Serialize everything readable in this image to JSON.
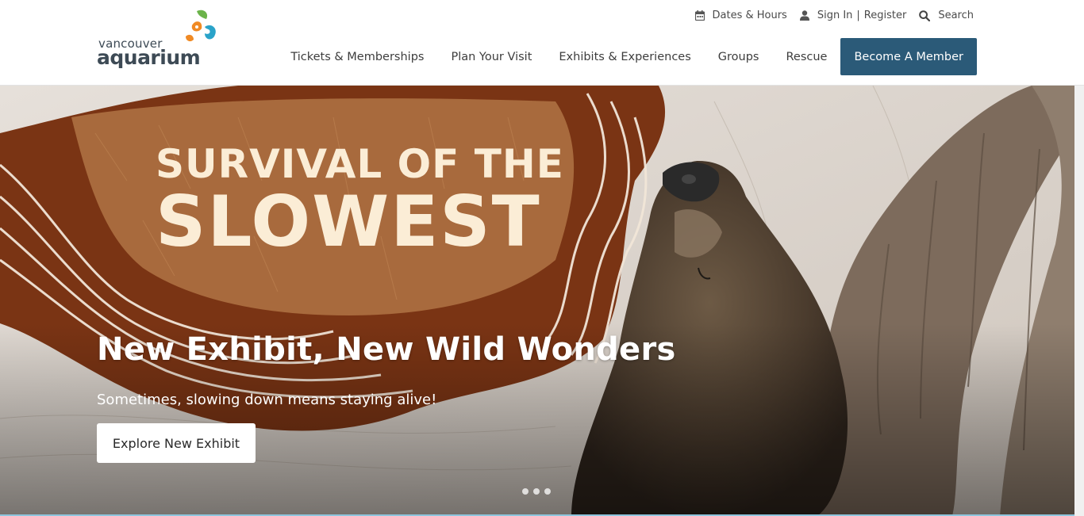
{
  "logo": {
    "line1": "vancouver",
    "line2": "aquarium",
    "mark_colors": [
      "#6bb34a",
      "#f08a24",
      "#2aa3c9"
    ]
  },
  "utility": {
    "dates_hours": "Dates & Hours",
    "sign_in": "Sign In",
    "separator": "|",
    "register": "Register",
    "search": "Search"
  },
  "nav": {
    "items": [
      "Tickets & Memberships",
      "Plan Your Visit",
      "Exhibits & Experiences",
      "Groups",
      "Rescue"
    ],
    "cta": "Become A Member"
  },
  "hero": {
    "art_title_line1": "SURVIVAL OF THE",
    "art_title_line2": "SLOWEST",
    "heading": "New Exhibit, New Wild Wonders",
    "subheading": "Sometimes, slowing down means staying alive!",
    "button": "Explore New Exhibit",
    "slides": 3
  },
  "colors": {
    "cta_bg": "#2b5a78",
    "art_brown": "#7a3414",
    "title_cream": "#fbedd6"
  }
}
